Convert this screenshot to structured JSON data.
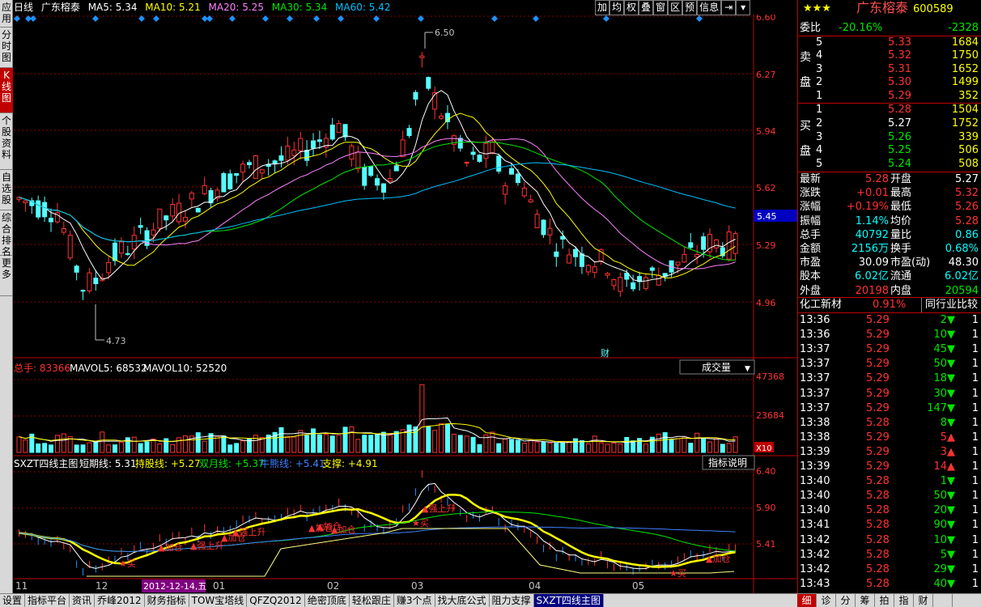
{
  "left_nav": [
    {
      "label": "应用",
      "active": false
    },
    {
      "label": "分时图",
      "active": false
    },
    {
      "label": "K线图",
      "active": true
    },
    {
      "label": "个股资料",
      "active": false
    },
    {
      "label": "自选股",
      "active": false
    },
    {
      "label": "综合排名",
      "active": false
    },
    {
      "label": "更多",
      "active": false
    }
  ],
  "header": {
    "period": "日线",
    "stock_name": "广东榕泰",
    "ma5": "MA5: 5.34",
    "ma10": "MA10: 5.21",
    "ma20": "MA20: 5.25",
    "ma30": "MA30: 5.34",
    "ma60": "MA60: 5.42"
  },
  "toolbar": [
    "加",
    "均",
    "权",
    "叠",
    "窗",
    "区",
    "预",
    "信息",
    "⇥",
    "▾"
  ],
  "colors": {
    "up": "#ff3232",
    "down": "#54ffff",
    "ma5": "#ffffff",
    "ma10": "#ffff00",
    "ma20": "#ff80ff",
    "ma30": "#00e600",
    "ma60": "#00c0ff",
    "grid": "#8b0000"
  },
  "price_axis": {
    "labels": [
      "6.60",
      "6.27",
      "5.94",
      "5.62",
      "5.29",
      "4.96"
    ],
    "current": "5.45"
  },
  "price_annotations": {
    "high": "6.50",
    "low": "4.73",
    "finance_marker": "财"
  },
  "volume_panel": {
    "title": "总手: 83366",
    "mavol5": "MAVOL5: 68532",
    "mavol10": "MAVOL10: 52520",
    "selector": "成交量",
    "axis_labels": [
      "47368",
      "23684"
    ],
    "unit": "X10"
  },
  "indicator_panel": {
    "name": "SXZT四线主图",
    "short": "短期线: 5.31",
    "hold": "持股线: +5.27",
    "dual": "双月线: +5.37",
    "bull": "牛熊线: +5.41",
    "support": "支撑: +4.91",
    "help_button": "指标说明",
    "axis_labels": [
      "6.40",
      "5.90",
      "5.41"
    ],
    "signals": [
      "买",
      "加仓",
      "强上升",
      "加仓",
      "强上升",
      "加仓",
      "加仓",
      "加仓",
      "强上升",
      "买",
      "买",
      "加仓"
    ]
  },
  "date_axis": {
    "labels": [
      "11",
      "12",
      "01",
      "02",
      "03",
      "04",
      "05"
    ],
    "cursor_date": "2012-12-14,五"
  },
  "quote": {
    "stars": "★★★",
    "name": "广东榕泰",
    "code": "600589",
    "weibi_label": "委比",
    "weibi": "-20.16%",
    "weicha": "-2328",
    "sell_label": [
      "卖",
      "盘"
    ],
    "buy_label": [
      "买",
      "盘"
    ],
    "sell": [
      {
        "level": "5",
        "price": "5.33",
        "vol": "1684"
      },
      {
        "level": "4",
        "price": "5.32",
        "vol": "1750"
      },
      {
        "level": "3",
        "price": "5.31",
        "vol": "1652"
      },
      {
        "level": "2",
        "price": "5.30",
        "vol": "1499"
      },
      {
        "level": "1",
        "price": "5.29",
        "vol": "352"
      }
    ],
    "buy": [
      {
        "level": "1",
        "price": "5.28",
        "vol": "1504"
      },
      {
        "level": "2",
        "price": "5.27",
        "vol": "1752"
      },
      {
        "level": "3",
        "price": "5.26",
        "vol": "339"
      },
      {
        "level": "4",
        "price": "5.25",
        "vol": "506"
      },
      {
        "level": "5",
        "price": "5.24",
        "vol": "508"
      }
    ],
    "stats": [
      {
        "l1": "最新",
        "v1": "5.28",
        "c1": "red",
        "l2": "开盘",
        "v2": "5.27",
        "c2": "white"
      },
      {
        "l1": "涨跌",
        "v1": "+0.01",
        "c1": "red",
        "l2": "最高",
        "v2": "5.32",
        "c2": "red"
      },
      {
        "l1": "涨幅",
        "v1": "+0.19%",
        "c1": "red",
        "l2": "最低",
        "v2": "5.26",
        "c2": "red"
      },
      {
        "l1": "振幅",
        "v1": "1.14%",
        "c1": "cyan",
        "l2": "均价",
        "v2": "5.28",
        "c2": "red"
      },
      {
        "l1": "总手",
        "v1": "40792",
        "c1": "cyan",
        "l2": "量比",
        "v2": "0.86",
        "c2": "cyan"
      },
      {
        "l1": "金额",
        "v1": "2156万",
        "c1": "cyan",
        "l2": "换手",
        "v2": "0.68%",
        "c2": "cyan"
      },
      {
        "l1": "市盈",
        "v1": "30.09",
        "c1": "white",
        "l2": "市盈(动)",
        "v2": "48.30",
        "c2": "white"
      },
      {
        "l1": "股本",
        "v1": "6.02亿",
        "c1": "cyan",
        "l2": "流通",
        "v2": "6.02亿",
        "c2": "cyan"
      },
      {
        "l1": "外盘",
        "v1": "20198",
        "c1": "red",
        "l2": "内盘",
        "v2": "20594",
        "c2": "green"
      }
    ],
    "sector": {
      "name": "化工新材",
      "change": "0.91%",
      "compare": "同行业比较"
    }
  },
  "ticks": [
    {
      "time": "13:36",
      "price": "5.29",
      "vol": "2",
      "dir": "down",
      "n": "1"
    },
    {
      "time": "13:36",
      "price": "5.29",
      "vol": "10",
      "dir": "down",
      "n": "1"
    },
    {
      "time": "13:37",
      "price": "5.29",
      "vol": "45",
      "dir": "down",
      "n": "1"
    },
    {
      "time": "13:37",
      "price": "5.29",
      "vol": "50",
      "dir": "down",
      "n": "1"
    },
    {
      "time": "13:37",
      "price": "5.29",
      "vol": "18",
      "dir": "down",
      "n": "1"
    },
    {
      "time": "13:37",
      "price": "5.29",
      "vol": "30",
      "dir": "down",
      "n": "1"
    },
    {
      "time": "13:37",
      "price": "5.29",
      "vol": "147",
      "dir": "down",
      "n": "1"
    },
    {
      "time": "13:38",
      "price": "5.28",
      "vol": "8",
      "dir": "down",
      "n": "1"
    },
    {
      "time": "13:38",
      "price": "5.29",
      "vol": "5",
      "dir": "up",
      "n": "1"
    },
    {
      "time": "13:39",
      "price": "5.29",
      "vol": "3",
      "dir": "up",
      "n": "1"
    },
    {
      "time": "13:39",
      "price": "5.29",
      "vol": "14",
      "dir": "up",
      "n": "1"
    },
    {
      "time": "13:40",
      "price": "5.28",
      "vol": "1",
      "dir": "down",
      "n": "1"
    },
    {
      "time": "13:40",
      "price": "5.28",
      "vol": "50",
      "dir": "down",
      "n": "1"
    },
    {
      "time": "13:40",
      "price": "5.28",
      "vol": "20",
      "dir": "down",
      "n": "1"
    },
    {
      "time": "13:41",
      "price": "5.28",
      "vol": "90",
      "dir": "down",
      "n": "1"
    },
    {
      "time": "13:42",
      "price": "5.28",
      "vol": "10",
      "dir": "down",
      "n": "1"
    },
    {
      "time": "13:42",
      "price": "5.28",
      "vol": "5",
      "dir": "down",
      "n": "1"
    },
    {
      "time": "13:42",
      "price": "5.28",
      "vol": "29",
      "dir": "down",
      "n": "1"
    },
    {
      "time": "13:43",
      "price": "5.28",
      "vol": "40",
      "dir": "down",
      "n": "1"
    }
  ],
  "bottom_tabs": [
    {
      "label": "设置",
      "active": false
    },
    {
      "label": "指标平台",
      "active": false
    },
    {
      "label": "资讯",
      "active": false
    },
    {
      "label": "乔峰2012",
      "active": false
    },
    {
      "label": "财务指标",
      "active": false
    },
    {
      "label": "TOW宝塔线",
      "active": false
    },
    {
      "label": "QFZQ2012",
      "active": false
    },
    {
      "label": "绝密顶底",
      "active": false
    },
    {
      "label": "轻松跟庄",
      "active": false
    },
    {
      "label": "赚3个点",
      "active": false
    },
    {
      "label": "找大底公式",
      "active": false
    },
    {
      "label": "阻力支撑",
      "active": false
    },
    {
      "label": "SXZT四线主图",
      "active": true
    }
  ],
  "right_tabs": [
    {
      "label": "细",
      "active": true
    },
    {
      "label": "诊",
      "active": false
    },
    {
      "label": "分",
      "active": false
    },
    {
      "label": "筹",
      "active": false
    },
    {
      "label": "拍",
      "active": false
    },
    {
      "label": "指",
      "active": false
    },
    {
      "label": "财",
      "active": false
    },
    {
      "label": "",
      "active": false
    }
  ]
}
